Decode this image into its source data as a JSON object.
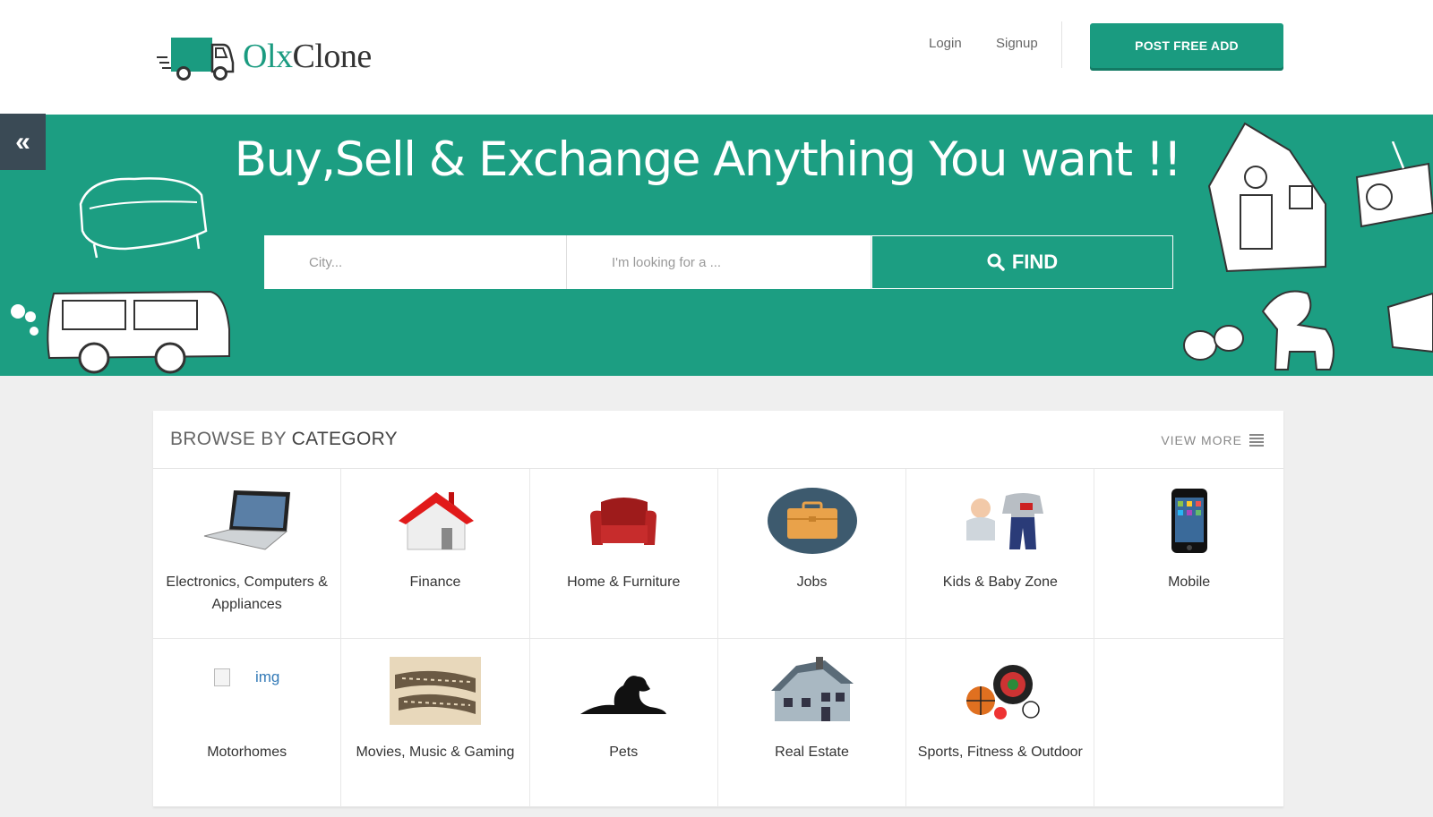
{
  "header": {
    "logo_text_a": "Olx",
    "logo_text_b": "Clone",
    "login": "Login",
    "signup": "Signup",
    "post_button": "POST FREE ADD"
  },
  "banner": {
    "headline": "Buy,Sell & Exchange Anything You want !!",
    "city_placeholder": "City...",
    "query_placeholder": "I'm looking for a ...",
    "find_button": "FIND",
    "toggle_icon": "«"
  },
  "categories": {
    "title_light": "BROWSE BY ",
    "title_bold": "CATEGORY",
    "view_more": "VIEW MORE",
    "broken_img_alt": "img",
    "items": [
      {
        "label": "Electronics, Computers & Appliances",
        "icon": "laptop-icon"
      },
      {
        "label": "Finance",
        "icon": "house-icon"
      },
      {
        "label": "Home & Furniture",
        "icon": "armchair-icon"
      },
      {
        "label": "Jobs",
        "icon": "briefcase-icon"
      },
      {
        "label": "Kids & Baby Zone",
        "icon": "baby-clothes-icon"
      },
      {
        "label": "Mobile",
        "icon": "phone-icon"
      },
      {
        "label": "Motorhomes",
        "icon": "broken-image-icon"
      },
      {
        "label": "Movies, Music & Gaming",
        "icon": "film-reel-icon"
      },
      {
        "label": "Pets",
        "icon": "dog-icon"
      },
      {
        "label": "Real Estate",
        "icon": "building-icon"
      },
      {
        "label": "Sports, Fitness & Outdoor",
        "icon": "sports-balls-icon"
      }
    ]
  },
  "colors": {
    "brand": "#1c9e82",
    "toggle_bg": "#3a4a55"
  }
}
